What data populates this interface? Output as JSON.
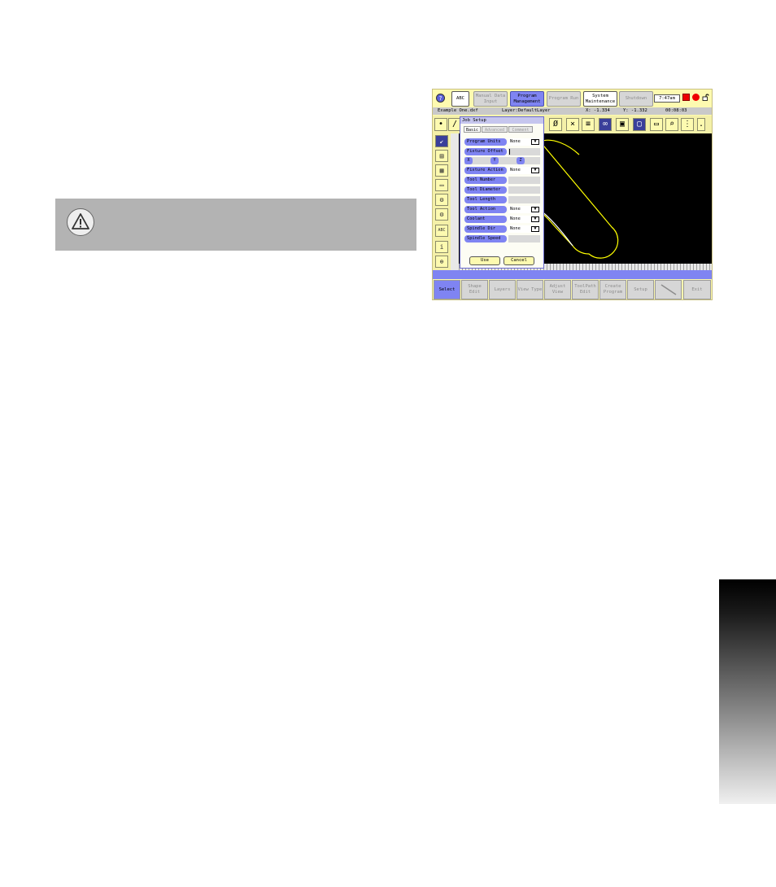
{
  "toolbar": {
    "help_label": "?",
    "abc_label": "ABC",
    "manual_data_input": "Manual Data Input",
    "program_management": "Program Management",
    "program_run": "Program Run",
    "system_maintenance": "System Maintenance",
    "shutdown": "Shutdown",
    "clock": "7:47am"
  },
  "infobar": {
    "filename": "Example One.dxf",
    "layer": "Layer:DefaultLayer",
    "x": "X: -1.334",
    "y": "Y: -1.332",
    "time": "00:08:03"
  },
  "dialog": {
    "title": "Job Setup",
    "tabs": [
      "Basic",
      "Advanced",
      "Comment"
    ],
    "fields": {
      "program_units": {
        "label": "Program Units",
        "value": "None"
      },
      "fixture_offset": {
        "label": "Fixture Offset",
        "value": ""
      },
      "fixture_action": {
        "label": "Fixture Action",
        "value": "None"
      },
      "tool_number": {
        "label": "Tool Number",
        "value": ""
      },
      "tool_diameter": {
        "label": "Tool Diameter",
        "value": ""
      },
      "tool_length": {
        "label": "Tool Length",
        "value": ""
      },
      "tool_action": {
        "label": "Tool Action",
        "value": "None"
      },
      "coolant": {
        "label": "Coolant",
        "value": "None"
      },
      "spindle_dir": {
        "label": "Spindle Dir",
        "value": "None"
      },
      "spindle_speed": {
        "label": "Spindle Speed",
        "value": ""
      }
    },
    "axes": {
      "x": "X",
      "y": "Y",
      "z": "Z"
    },
    "use_label": "Use",
    "cancel_label": "Cancel"
  },
  "softkeys": {
    "select": "Select",
    "shape_edit": "Shape Edit",
    "layers": "Layers",
    "view_type": "View Type",
    "adjust_view": "Adjust View",
    "toolpath_edit": "ToolPath Edit",
    "create_program": "Create Program",
    "setup": "Setup",
    "exit": "Exit"
  },
  "colors": {
    "accent": "#7f84f2",
    "screen_bg": "#fdfab0",
    "canvas_bg": "#000000",
    "shape_line": "#ffff00"
  },
  "icons": [
    "warning-icon",
    "help-icon",
    "lock-icon",
    "record-icon",
    "alarm-icon"
  ]
}
